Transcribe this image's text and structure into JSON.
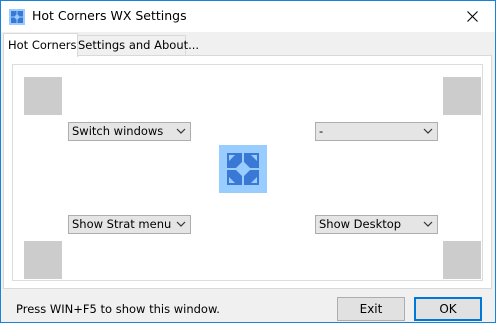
{
  "window": {
    "title": "Hot Corners WX Settings",
    "icon": "hot-corners-app-icon",
    "close_icon": "close-icon"
  },
  "tabs": [
    {
      "label": "Hot Corners",
      "active": true
    },
    {
      "label": "Settings and About...",
      "active": false
    }
  ],
  "corners": {
    "top_left": {
      "action": "Switch windows"
    },
    "top_right": {
      "action": "-"
    },
    "bottom_left": {
      "action": "Show Strat menu"
    },
    "bottom_right": {
      "action": "Show Desktop"
    }
  },
  "colors": {
    "accent": "#1883d7",
    "center_icon_bg": "#99ccff",
    "center_icon_fg": "#3a78d6",
    "corner_box": "#cccccc"
  },
  "status": {
    "text": "Press WIN+F5 to show this window."
  },
  "buttons": {
    "exit": "Exit",
    "ok": "OK"
  }
}
